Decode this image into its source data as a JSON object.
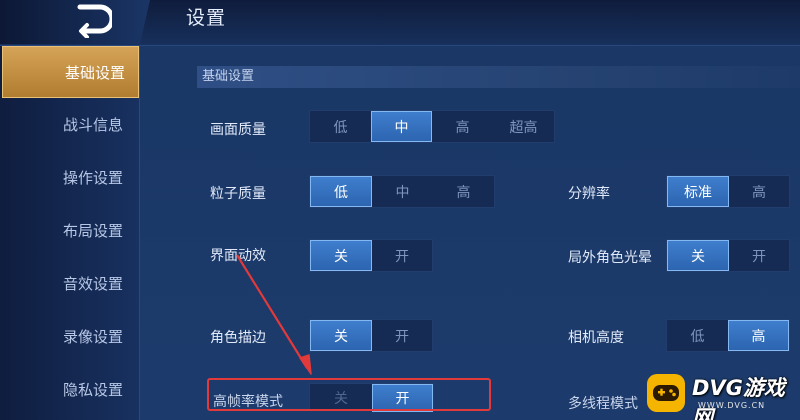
{
  "header": {
    "title": "设置"
  },
  "sidebar": {
    "items": [
      {
        "label": "基础设置",
        "active": true
      },
      {
        "label": "战斗信息",
        "active": false
      },
      {
        "label": "操作设置",
        "active": false
      },
      {
        "label": "布局设置",
        "active": false
      },
      {
        "label": "音效设置",
        "active": false
      },
      {
        "label": "录像设置",
        "active": false
      },
      {
        "label": "隐私设置",
        "active": false
      }
    ]
  },
  "main": {
    "section_title": "基础设置",
    "settings": {
      "picture_quality": {
        "label": "画面质量",
        "options": [
          "低",
          "中",
          "高",
          "超高"
        ],
        "selected": "中"
      },
      "particle_quality": {
        "label": "粒子质量",
        "options": [
          "低",
          "中",
          "高"
        ],
        "selected": "低"
      },
      "resolution": {
        "label": "分辨率",
        "options": [
          "标准",
          "高"
        ],
        "selected": "标准"
      },
      "ui_animation": {
        "label": "界面动效",
        "options": [
          "关",
          "开"
        ],
        "selected": "关"
      },
      "outside_halo": {
        "label": "局外角色光晕",
        "options": [
          "关",
          "开"
        ],
        "selected": "关"
      },
      "character_outline": {
        "label": "角色描边",
        "options": [
          "关",
          "开"
        ],
        "selected": "关"
      },
      "camera_height": {
        "label": "相机高度",
        "options": [
          "低",
          "高"
        ],
        "selected": "高"
      },
      "high_frame_rate": {
        "label": "高帧率模式",
        "options": [
          "关",
          "开"
        ],
        "selected": "开"
      },
      "multi_thread": {
        "label": "多线程模式"
      }
    }
  },
  "watermark": {
    "text": "DVG游戏网",
    "sub": "WWW.DVG.CN"
  },
  "colors": {
    "accent_gold": "#c8923f",
    "selected_blue": "#3572c0",
    "annotation_red": "#e23a3a",
    "watermark_yellow": "#f5b400"
  }
}
